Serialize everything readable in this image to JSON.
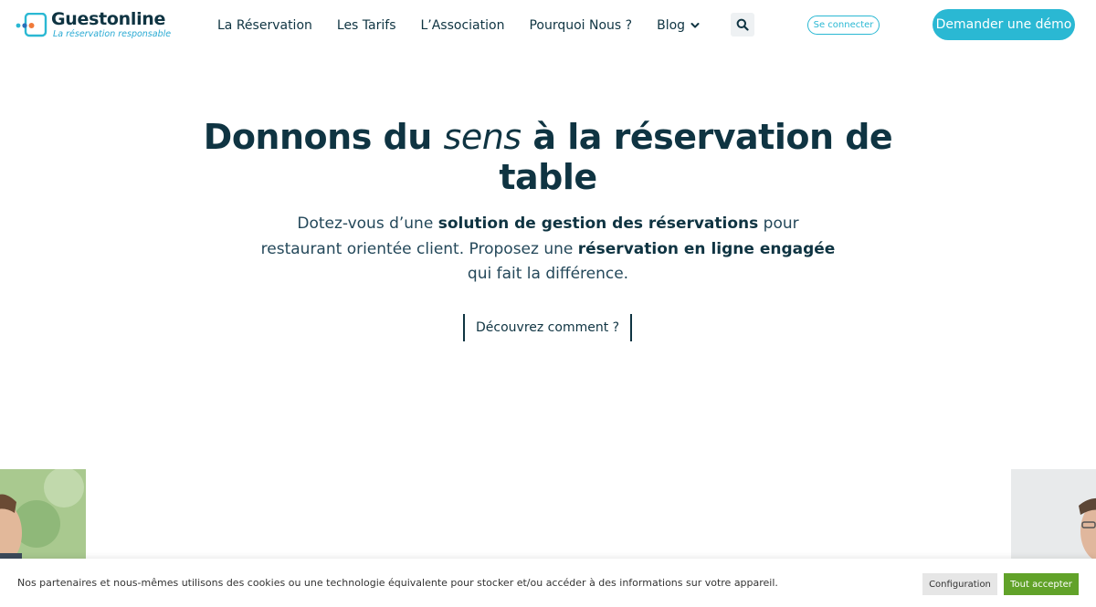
{
  "brand": {
    "name": "Guestonline",
    "tagline": "La réservation responsable",
    "colors": {
      "primary": "#2ab8d3",
      "text": "#0f3442",
      "accept": "#61a229"
    }
  },
  "nav": {
    "items": [
      {
        "label": "La Réservation"
      },
      {
        "label": "Les Tarifs"
      },
      {
        "label": "L’Association"
      },
      {
        "label": "Pourquoi Nous ?"
      },
      {
        "label": "Blog",
        "dropdown": true
      }
    ],
    "search_icon": "search-icon",
    "login_label": "Se connecter",
    "demo_label": "Demander une démo"
  },
  "hero": {
    "title_before": "Donnons du ",
    "title_emphasis": "sens",
    "title_after": " à la réservation de table",
    "sub": [
      {
        "text": "Dotez-vous d’une ",
        "bold": false
      },
      {
        "text": "solution de gestion des réservations",
        "bold": true
      },
      {
        "text": " pour restaurant orientée client. Proposez une ",
        "bold": false
      },
      {
        "text": "réservation en ligne engagée",
        "bold": true
      },
      {
        "text": " qui fait la différence.",
        "bold": false
      }
    ],
    "cta_label": "Découvrez comment ?"
  },
  "cookie": {
    "text": "Nos partenaires et nous-mêmes utilisons des cookies ou une technologie équivalente pour stocker et/ou accéder à des informations sur votre appareil.",
    "config_label": "Configuration",
    "accept_label": "Tout accepter"
  }
}
